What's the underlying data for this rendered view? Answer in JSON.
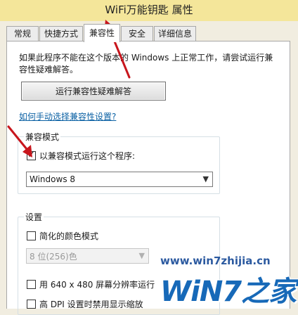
{
  "window": {
    "title": "WiFi万能钥匙 属性"
  },
  "tabs": [
    {
      "label": "常规"
    },
    {
      "label": "快捷方式"
    },
    {
      "label": "兼容性"
    },
    {
      "label": "安全"
    },
    {
      "label": "详细信息"
    }
  ],
  "compat": {
    "intro": "如果此程序不能在这个版本的 Windows 上正常工作，请尝试运行兼容性疑难解答。",
    "troubleshoot_button": "运行兼容性疑难解答",
    "manual_link": "如何手动选择兼容性设置?",
    "mode_group": {
      "title": "兼容模式",
      "checkbox_label": "以兼容模式运行这个程序:",
      "checked": true,
      "selected_os": "Windows 8"
    },
    "settings_group": {
      "title": "设置",
      "reduced_color_label": "简化的颜色模式",
      "reduced_color_checked": false,
      "color_select": "8 位(256)色",
      "res_640_label": "用 640 x 480 屏幕分辨率运行",
      "res_640_checked": false,
      "dpi_label": "高 DPI 设置时禁用显示缩放",
      "dpi_checked": false
    }
  },
  "watermark": {
    "url": "www.win7zhijia.cn",
    "logo": "WiN7之家"
  },
  "colors": {
    "accent_arrow": "#c8161d",
    "link": "#0b61a4",
    "titlebar": "#f4e69a"
  }
}
